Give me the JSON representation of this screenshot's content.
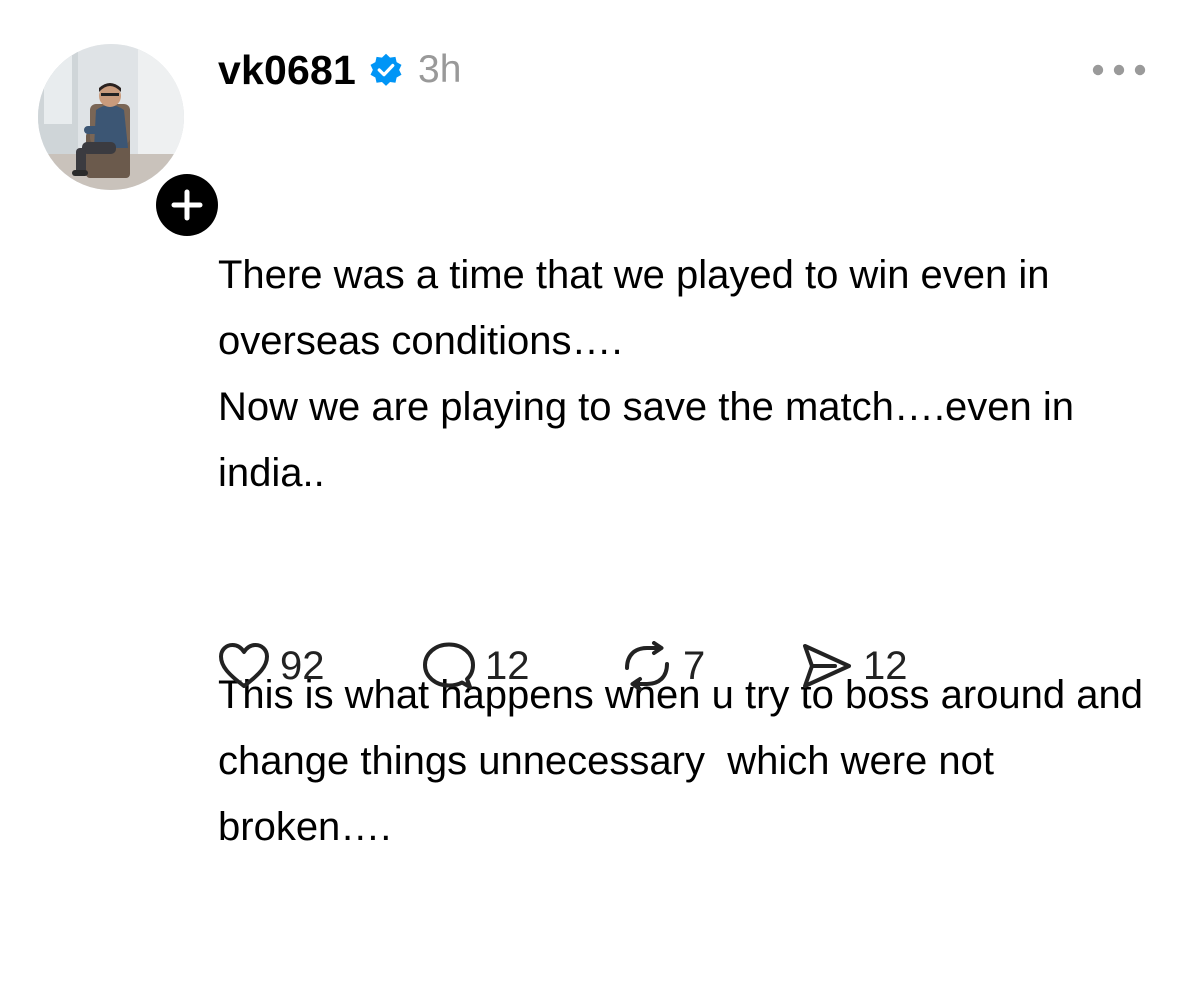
{
  "post": {
    "username": "vk0681",
    "timestamp": "3h",
    "paragraph_1": "There was a time that we played to win even in overseas conditions….\nNow we are playing to save the match….even in india..",
    "paragraph_2": "This is what happens when u try to boss around and change things unnecessary  which were not broken….",
    "likes": "92",
    "replies": "12",
    "reposts": "7",
    "shares": "12"
  },
  "icons": {
    "verified": "verified-badge-icon",
    "follow": "plus-icon",
    "more": "more-dots-icon",
    "like": "heart-icon",
    "reply": "speech-bubble-icon",
    "repost": "repost-arrows-icon",
    "share": "send-icon"
  },
  "colors": {
    "verified_blue": "#0095f6",
    "timestamp_gray": "#999999",
    "text": "#000000"
  }
}
